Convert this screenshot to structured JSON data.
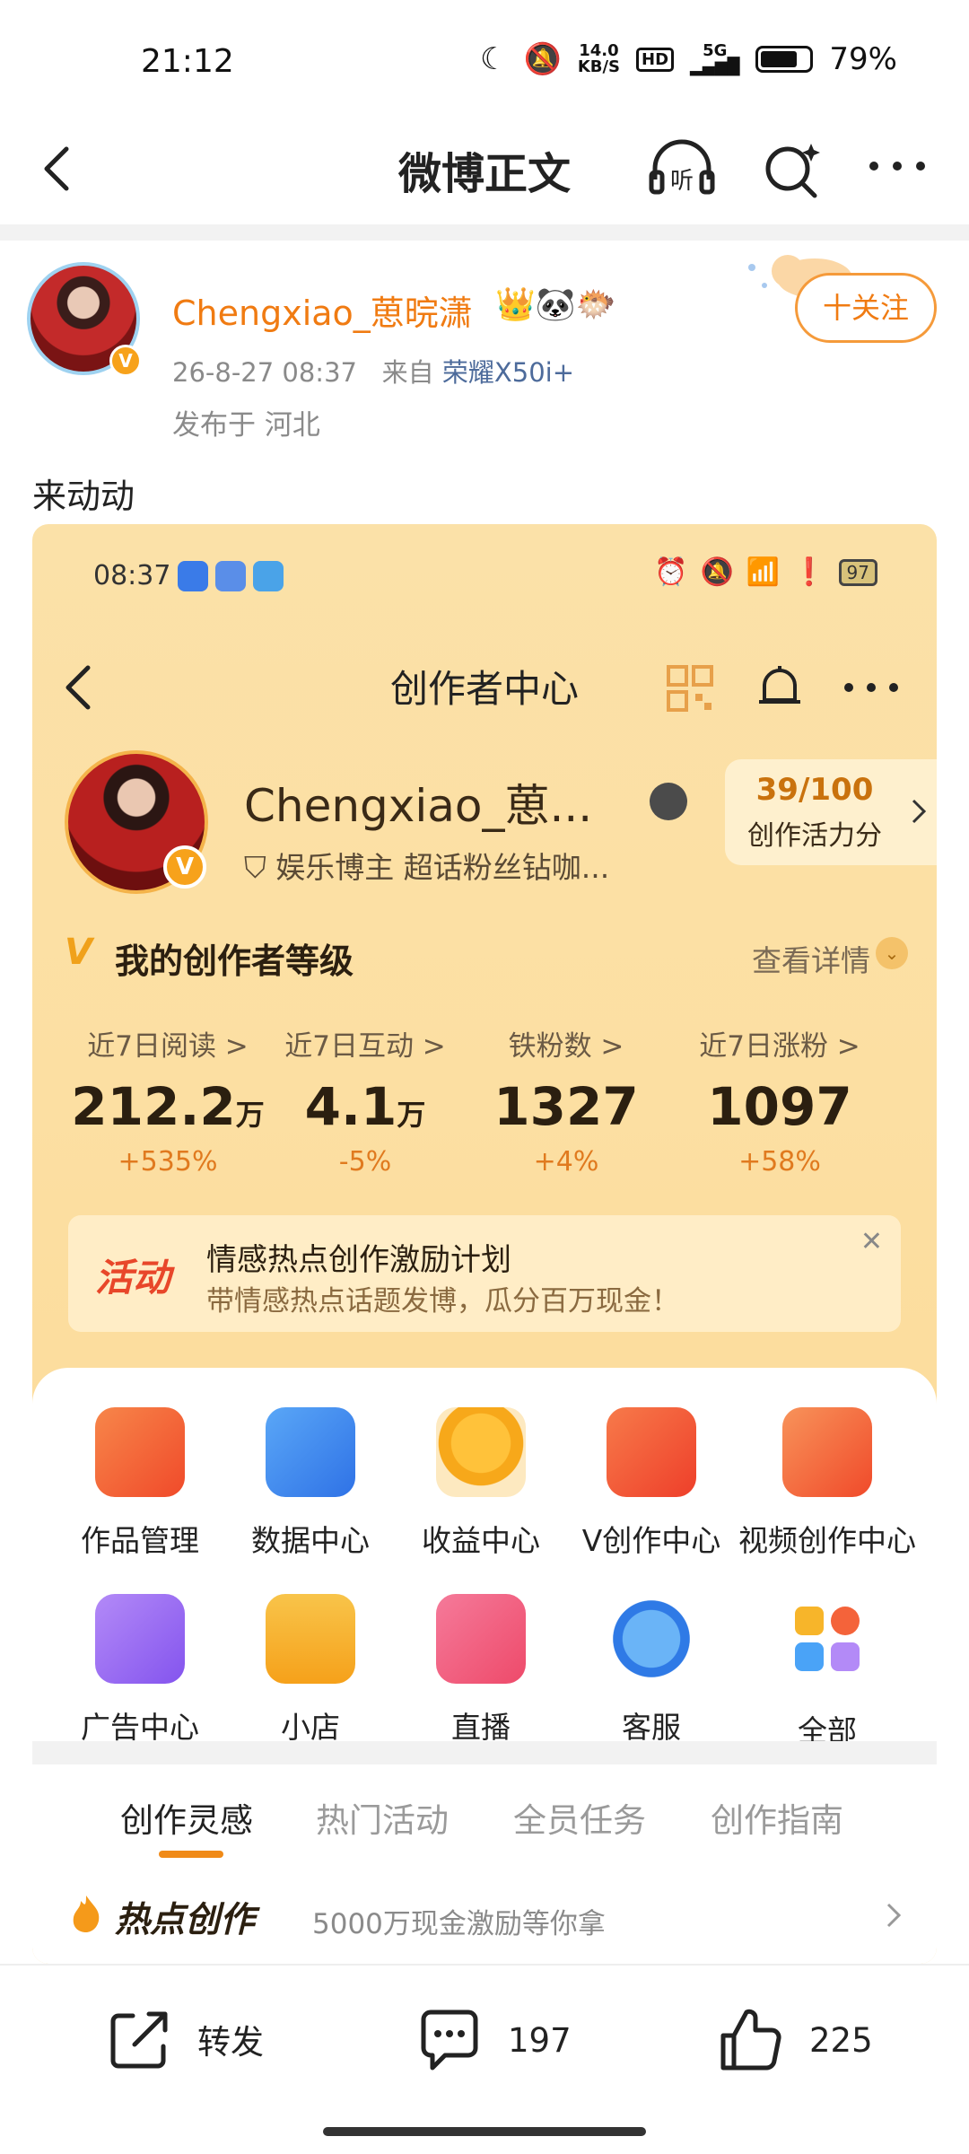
{
  "status_bar": {
    "time": "21:12",
    "net_speed_top": "14.0",
    "net_speed_bottom": "KB/S",
    "hd": "HD",
    "network": "5G",
    "battery": "79%"
  },
  "nav": {
    "title": "微博正文"
  },
  "post": {
    "author_name": "Chengxiao_葸晥潇",
    "emojis": "👑🐼🐡",
    "timestamp": "26-8-27 08:37",
    "source_prefix": "来自",
    "device": "荣耀X50i+",
    "location": "发布于 河北",
    "follow_label": "十关注",
    "text": "来动动"
  },
  "screenshot": {
    "status_time": "08:37",
    "battery": "97",
    "title": "创作者中心",
    "creator_name": "Chengxiao_葸...",
    "creator_tag": "娱乐博主 超话粉丝钻咖...",
    "score_value": "39/100",
    "score_label": "创作活力分",
    "level_title": "我的创作者等级",
    "level_link": "查看详情",
    "stats": [
      {
        "label": "近7日阅读 >",
        "value": "212.2",
        "unit": "万",
        "change": "+535%"
      },
      {
        "label": "近7日互动 >",
        "value": "4.1",
        "unit": "万",
        "change": "-5%"
      },
      {
        "label": "铁粉数 >",
        "value": "1327",
        "unit": "",
        "change": "+4%"
      },
      {
        "label": "近7日涨粉 >",
        "value": "1097",
        "unit": "",
        "change": "+58%"
      }
    ],
    "activity": {
      "tag": "活动",
      "title": "情感热点创作激励计划",
      "subtitle": "带情感热点话题发博，瓜分百万现金！"
    },
    "grid": [
      {
        "label": "作品管理",
        "icon": "works-icon",
        "color": "#f4633a"
      },
      {
        "label": "数据中心",
        "icon": "data-icon",
        "color": "#3f8ef0"
      },
      {
        "label": "收益中心",
        "icon": "income-icon",
        "color": "#f7a81a"
      },
      {
        "label": "V创作中心",
        "icon": "v-create-icon",
        "color": "#f2553a"
      },
      {
        "label": "视频创作中心",
        "icon": "video-icon",
        "color": "#f4633a"
      },
      {
        "label": "广告中心",
        "icon": "ad-icon",
        "color": "#9b6ef2"
      },
      {
        "label": "小店",
        "icon": "shop-icon",
        "color": "#f7b52a"
      },
      {
        "label": "直播",
        "icon": "live-icon",
        "color": "#f25a7a"
      },
      {
        "label": "客服",
        "icon": "service-icon",
        "color": "#3f8ef0"
      },
      {
        "label": "全部",
        "icon": "all-icon",
        "color": "#f4633a"
      }
    ],
    "tabs": [
      "创作灵感",
      "热门活动",
      "全员任务",
      "创作指南"
    ],
    "hot_title": "热点创作",
    "hot_subtitle": "5000万现金激励等你拿"
  },
  "bottom_bar": {
    "repost_label": "转发",
    "comment_count": "197",
    "like_count": "225"
  },
  "colors": {
    "accent_orange": "#f07b12",
    "card_bg": "#fcdfa2"
  }
}
